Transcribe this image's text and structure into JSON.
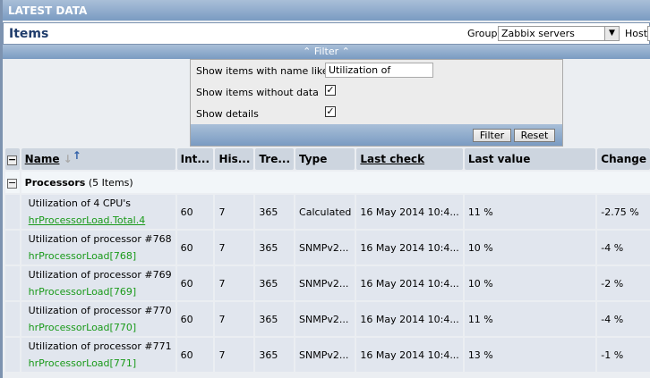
{
  "header": {
    "title": "LATEST DATA"
  },
  "titlebar": {
    "title": "Items",
    "group_label": "Group",
    "group_value": "Zabbix servers",
    "host_label": "Host"
  },
  "filter": {
    "bar_label": "Filter",
    "name_label": "Show items with name like",
    "name_value": "Utilization of",
    "without_data_label": "Show items without data",
    "without_data_checked": true,
    "details_label": "Show details",
    "details_checked": true,
    "filter_button": "Filter",
    "reset_button": "Reset"
  },
  "table": {
    "headers": {
      "name": "Name",
      "interval": "Int...",
      "history": "His...",
      "trends": "Tre...",
      "type": "Type",
      "last_check": "Last check",
      "last_value": "Last value",
      "change": "Change"
    },
    "group": {
      "name": "Processors",
      "count": "(5 Items)"
    },
    "rows": [
      {
        "name": "Utilization of 4 CPU's",
        "key": "hrProcessorLoad.Total.4",
        "interval": "60",
        "history": "7",
        "trends": "365",
        "type": "Calculated",
        "last_check": "16 May 2014 10:4...",
        "last_value": "11 %",
        "change": "-2.75 %"
      },
      {
        "name": "Utilization of processor #768",
        "key": "hrProcessorLoad[768]",
        "interval": "60",
        "history": "7",
        "trends": "365",
        "type": "SNMPv2...",
        "last_check": "16 May 2014 10:4...",
        "last_value": "10 %",
        "change": "-4 %"
      },
      {
        "name": "Utilization of processor #769",
        "key": "hrProcessorLoad[769]",
        "interval": "60",
        "history": "7",
        "trends": "365",
        "type": "SNMPv2...",
        "last_check": "16 May 2014 10:4...",
        "last_value": "10 %",
        "change": "-2 %"
      },
      {
        "name": "Utilization of processor #770",
        "key": "hrProcessorLoad[770]",
        "interval": "60",
        "history": "7",
        "trends": "365",
        "type": "SNMPv2...",
        "last_check": "16 May 2014 10:4...",
        "last_value": "11 %",
        "change": "-4 %"
      },
      {
        "name": "Utilization of processor #771",
        "key": "hrProcessorLoad[771]",
        "interval": "60",
        "history": "7",
        "trends": "365",
        "type": "SNMPv2...",
        "last_check": "16 May 2014 10:4...",
        "last_value": "13 %",
        "change": "-1 %"
      }
    ]
  }
}
